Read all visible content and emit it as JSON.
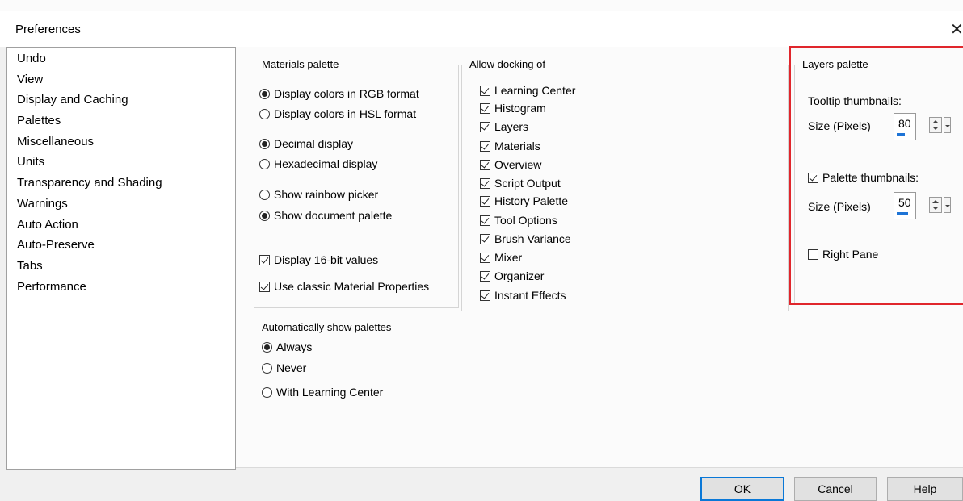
{
  "window": {
    "title": "Preferences",
    "close_glyph": "✕"
  },
  "nav": {
    "items": [
      "Undo",
      "View",
      "Display and Caching",
      "Palettes",
      "Miscellaneous",
      "Units",
      "Transparency and Shading",
      "Warnings",
      "Auto Action",
      "Auto-Preserve",
      "Tabs",
      "Performance"
    ],
    "selected": "Palettes"
  },
  "materials": {
    "legend": "Materials palette",
    "rgb": "Display colors in RGB format",
    "hsl": "Display colors in HSL format",
    "decimal": "Decimal display",
    "hex": "Hexadecimal display",
    "rainbow": "Show rainbow picker",
    "document": "Show document palette",
    "sixteen_bit": "Display 16-bit values",
    "classic": "Use classic Material Properties"
  },
  "docking": {
    "legend": "Allow docking of",
    "items": [
      "Learning Center",
      "Histogram",
      "Layers",
      "Materials",
      "Overview",
      "Script Output",
      "History Palette",
      "Tool Options",
      "Brush Variance",
      "Mixer",
      "Organizer",
      "Instant Effects"
    ]
  },
  "layers": {
    "legend": "Layers palette",
    "tooltip_label": "Tooltip thumbnails:",
    "size_label": "Size (Pixels)",
    "tooltip_size": "80",
    "palette_thumbs": "Palette thumbnails:",
    "palette_size": "50",
    "right_pane": "Right Pane"
  },
  "autoshow": {
    "legend": "Automatically show palettes",
    "always": "Always",
    "never": "Never",
    "with_lc": "With Learning Center"
  },
  "buttons": {
    "ok": "OK",
    "cancel": "Cancel",
    "help": "Help"
  },
  "colors": {
    "highlight": "#e0262c",
    "accent": "#1e74d6",
    "default_button_border": "#0a78d7"
  }
}
